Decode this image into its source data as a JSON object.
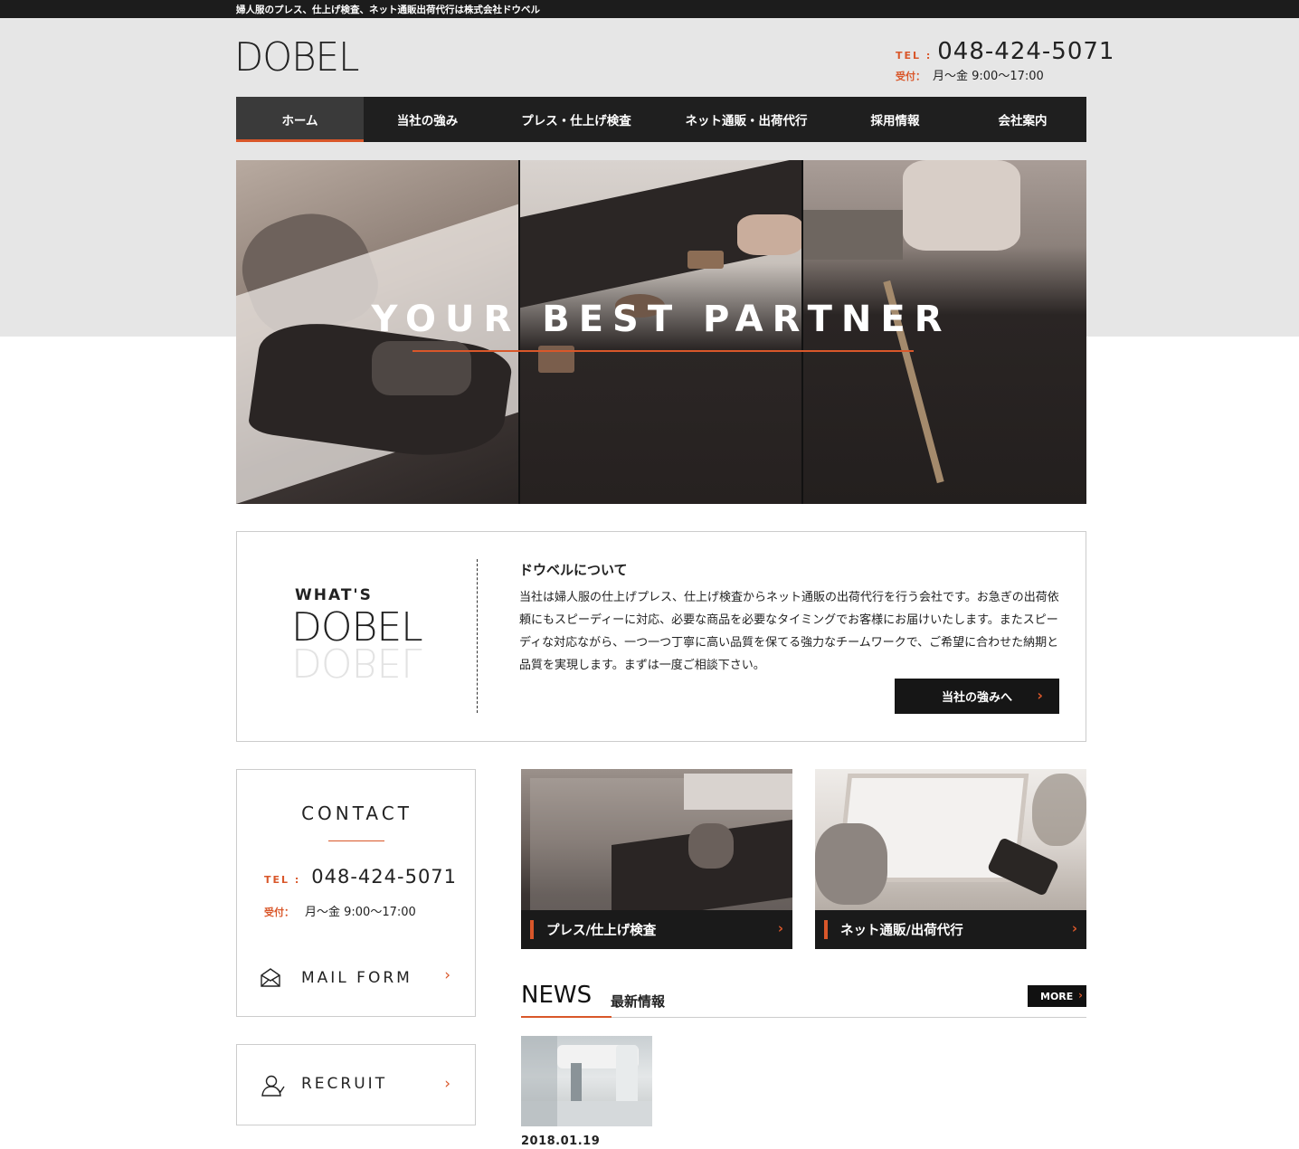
{
  "topbar": {
    "tagline": "婦人服のプレス、仕上げ検査、ネット通販出荷代行は株式会社ドウベル"
  },
  "header": {
    "logo": "DOBEL",
    "tel_label": "TEL :",
    "tel_number": "048-424-5071",
    "hours_label": "受付：",
    "hours_value": "月〜金 9:00〜17:00"
  },
  "nav": {
    "items": [
      {
        "label": "ホーム",
        "active": true
      },
      {
        "label": "当社の強み",
        "active": false
      },
      {
        "label": "プレス・仕上げ検査",
        "active": false
      },
      {
        "label": "ネット通販・出荷代行",
        "active": false
      },
      {
        "label": "採用情報",
        "active": false
      },
      {
        "label": "会社案内",
        "active": false
      }
    ]
  },
  "hero": {
    "title": "YOUR BEST PARTNER"
  },
  "about": {
    "whats": "WHAT'S",
    "logo": "DOBEL",
    "heading": "ドウベルについて",
    "body": "当社は婦人服の仕上げプレス、仕上げ検査からネット通販の出荷代行を行う会社です。お急ぎの出荷依頼にもスピーディーに対応、必要な商品を必要なタイミングでお客様にお届けいたします。またスピーディな対応ながら、一つ一つ丁寧に高い品質を保てる強力なチームワークで、ご希望に合わせた納期と品質を実現します。まずは一度ご相談下さい。",
    "button_label": "当社の強みへ"
  },
  "contact": {
    "heading": "CONTACT",
    "tel_label": "TEL :",
    "tel_number": "048-424-5071",
    "hours_label": "受付：",
    "hours_value": "月〜金 9:00〜17:00",
    "mail_label": "MAIL FORM"
  },
  "recruit": {
    "label": "RECRUIT"
  },
  "cards": [
    {
      "label": "プレス/仕上げ検査"
    },
    {
      "label": "ネット通販/出荷代行"
    }
  ],
  "news": {
    "heading": "NEWS",
    "subheading": "最新情報",
    "more_label": "MORE",
    "items": [
      {
        "date": "2018.01.19"
      }
    ]
  },
  "colors": {
    "accent": "#d9572a",
    "dark": "#1f1f1f",
    "header_bg": "#e6e6e6"
  },
  "icons": [
    "chevron-right-icon",
    "envelope-icon",
    "person-icon"
  ]
}
